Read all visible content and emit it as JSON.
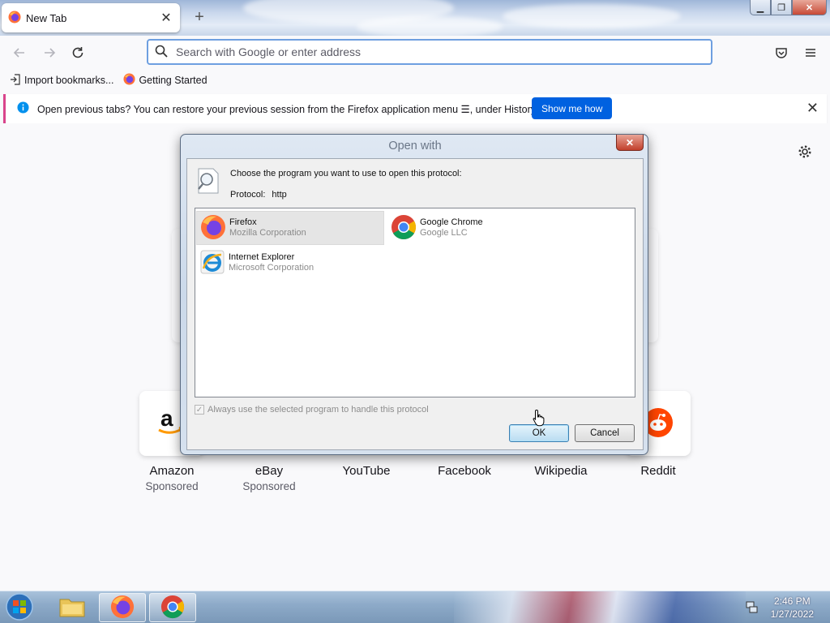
{
  "browser": {
    "tab": {
      "title": "New Tab"
    },
    "new_tab_symbol": "+",
    "urlbar": {
      "placeholder": "Search with Google or enter address",
      "value": ""
    },
    "bookmarks": [
      {
        "label": "Import bookmarks...",
        "icon": "import-icon"
      },
      {
        "label": "Getting Started",
        "icon": "firefox-icon"
      }
    ],
    "notification": {
      "message": "Open previous tabs? You can restore your previous session from the Firefox application menu ☰, under History.",
      "button": "Show me how"
    },
    "top_sites": [
      {
        "name": "Amazon",
        "sub": "Sponsored"
      },
      {
        "name": "eBay",
        "sub": "Sponsored"
      },
      {
        "name": "YouTube",
        "sub": ""
      },
      {
        "name": "Facebook",
        "sub": ""
      },
      {
        "name": "Wikipedia",
        "sub": ""
      },
      {
        "name": "Reddit",
        "sub": ""
      }
    ]
  },
  "dialog": {
    "title": "Open with",
    "prompt": "Choose the program you want to use to open this protocol:",
    "protocol_label": "Protocol:",
    "protocol_value": "http",
    "apps": [
      {
        "name": "Firefox",
        "company": "Mozilla Corporation",
        "selected": true
      },
      {
        "name": "Google Chrome",
        "company": "Google LLC",
        "selected": false
      },
      {
        "name": "Internet Explorer",
        "company": "Microsoft Corporation",
        "selected": false
      }
    ],
    "always_label": "Always use the selected program to handle this protocol",
    "always_checked": true,
    "ok": "OK",
    "cancel": "Cancel"
  },
  "taskbar": {
    "time": "2:46 PM",
    "date": "1/27/2022"
  },
  "colors": {
    "accent": "#0061e0",
    "notice_stripe": "#d9448c"
  }
}
